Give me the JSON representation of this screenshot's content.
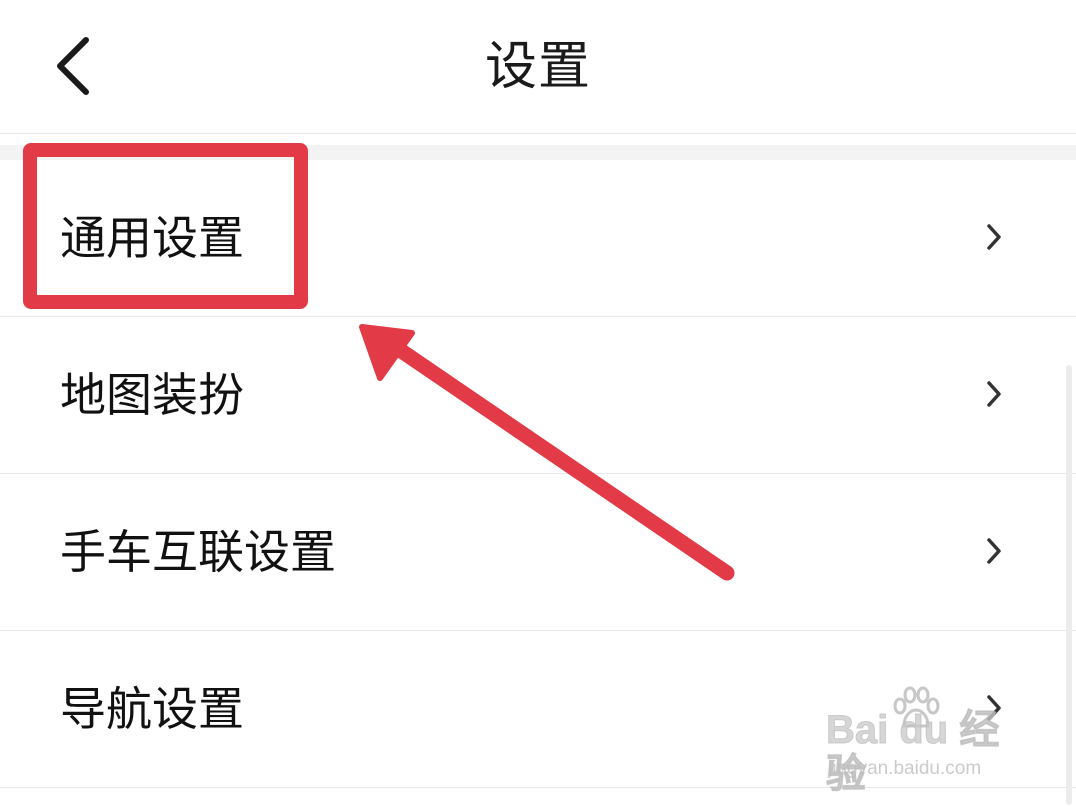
{
  "header": {
    "title": "设置",
    "back_icon": "chevron-left-icon"
  },
  "settings_list": {
    "items": [
      {
        "label": "通用设置",
        "icon": "chevron-right-icon"
      },
      {
        "label": "地图装扮",
        "icon": "chevron-right-icon"
      },
      {
        "label": "手车互联设置",
        "icon": "chevron-right-icon"
      },
      {
        "label": "导航设置",
        "icon": "chevron-right-icon"
      }
    ]
  },
  "annotation": {
    "highlight_color": "#e23a46",
    "arrow_color": "#e23a46"
  },
  "watermark": {
    "main": "Bai du 经验",
    "sub": "jingyan.baidu.com",
    "icon": "baidu-paw-icon"
  }
}
